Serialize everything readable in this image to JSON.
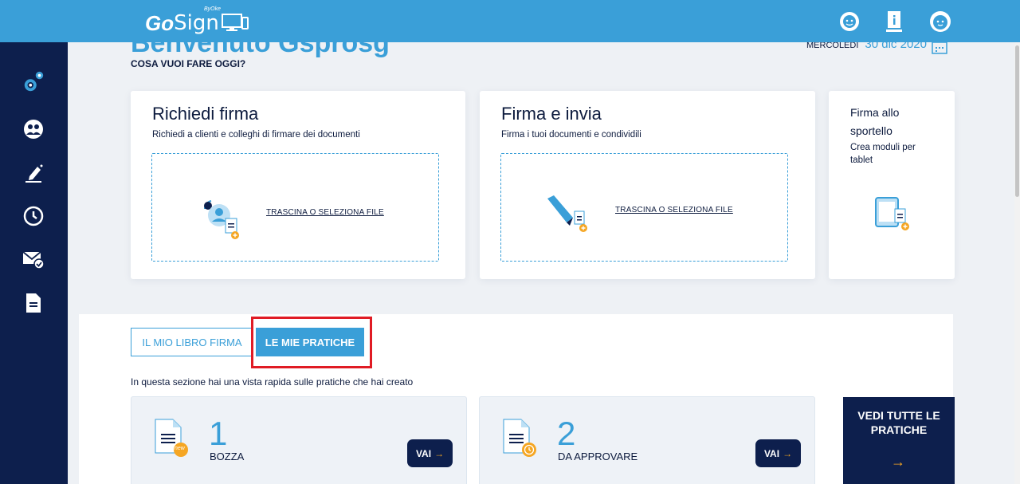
{
  "app": {
    "logo_prefix": "Go",
    "logo_suffix": "Sign",
    "logo_by": "ByOke"
  },
  "header": {
    "welcome": "Benvenuto Gsprosg",
    "subtitle": "COSA VUOI FARE OGGI?",
    "weekday": "MERCOLEDÌ",
    "date": "30 dic 2020"
  },
  "cards": [
    {
      "title": "Richiedi firma",
      "description": "Richiedi a clienti e colleghi di firmare dei documenti",
      "link": "TRASCINA O SELEZIONA FILE"
    },
    {
      "title": "Firma e invia",
      "description": "Firma i tuoi documenti e condividili",
      "link": "TRASCINA O SELEZIONA FILE"
    },
    {
      "title": "Firma allo sportello",
      "description": "Crea moduli per tablet"
    }
  ],
  "tabs": {
    "libro": "IL MIO LIBRO FIRMA",
    "pratiche": "LE MIE PRATICHE"
  },
  "section_info": "In questa sezione hai una vista rapida sulle pratiche che hai creato",
  "stats": [
    {
      "count": "1",
      "label": "BOZZA",
      "button": "VAI",
      "badge": "new"
    },
    {
      "count": "2",
      "label": "DA APPROVARE",
      "button": "VAI"
    }
  ],
  "see_all": "VEDI TUTTE LE PRATICHE",
  "colors": {
    "primary": "#3a9fd8",
    "navy": "#0d1f4d",
    "accent": "#f5a623",
    "highlight": "#e01b24"
  },
  "icons": {
    "top": [
      "support-agent-icon",
      "info-document-icon",
      "user-avatar-icon"
    ],
    "sidebar": [
      "settings-gear-icon",
      "people-icon",
      "signature-pen-icon",
      "clock-icon",
      "mail-check-icon",
      "document-icon"
    ]
  }
}
